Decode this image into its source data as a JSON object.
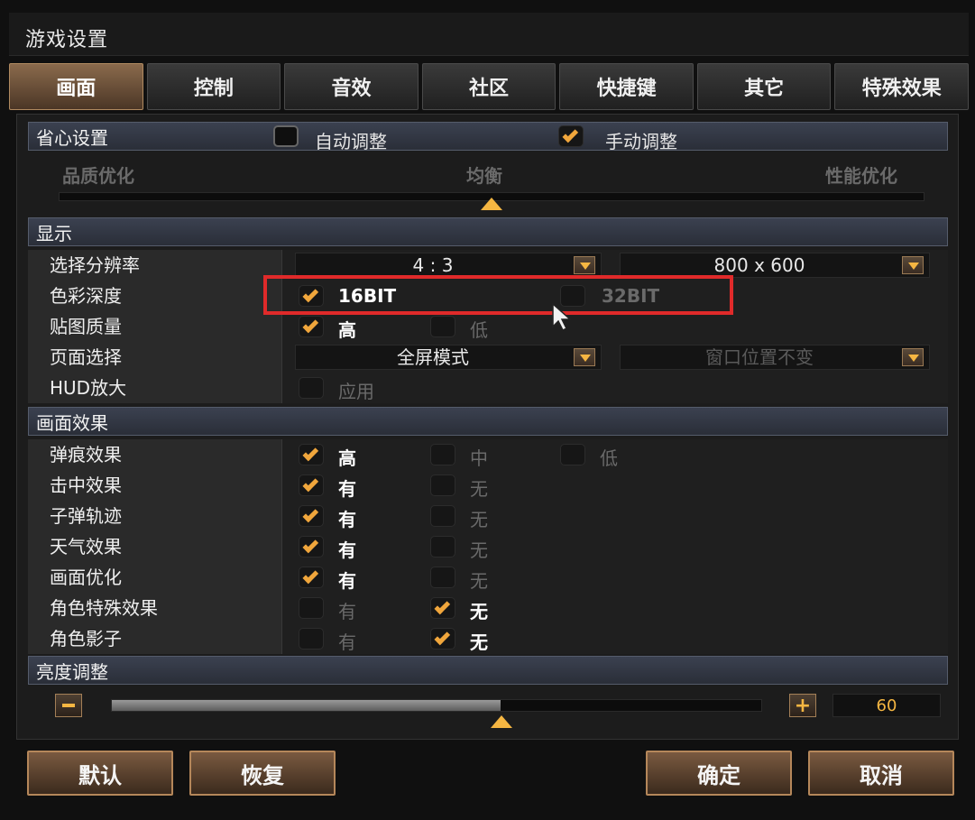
{
  "window": {
    "title": "游戏设置"
  },
  "tabs": [
    {
      "label": "画面",
      "active": true
    },
    {
      "label": "控制",
      "active": false
    },
    {
      "label": "音效",
      "active": false
    },
    {
      "label": "社区",
      "active": false
    },
    {
      "label": "快捷键",
      "active": false
    },
    {
      "label": "其它",
      "active": false
    },
    {
      "label": "特殊效果",
      "active": false
    }
  ],
  "easy": {
    "title": "省心设置",
    "auto_label": "自动调整",
    "auto_checked": false,
    "manual_label": "手动调整",
    "manual_checked": true,
    "quality_label": "品质优化",
    "balanced_label": "均衡",
    "performance_label": "性能优化",
    "slider_position": 0.5
  },
  "display": {
    "title": "显示",
    "resolution_label": "选择分辨率",
    "aspect_value": "4 : 3",
    "resolution_value": "800 x 600",
    "color_label": "色彩深度",
    "color_16": "16BIT",
    "color_16_checked": true,
    "color_32": "32BIT",
    "color_32_checked": false,
    "texture_label": "贴图质量",
    "texture_high": "高",
    "texture_high_checked": true,
    "texture_low": "低",
    "texture_low_checked": false,
    "page_label": "页面选择",
    "page_mode": "全屏模式",
    "window_position": "窗口位置不变",
    "hud_label": "HUD放大",
    "hud_apply": "应用",
    "hud_checked": false
  },
  "effects": {
    "title": "画面效果",
    "rows": [
      {
        "label": "弹痕效果",
        "options": [
          {
            "text": "高",
            "checked": true
          },
          {
            "text": "中",
            "checked": false
          },
          {
            "text": "低",
            "checked": false
          }
        ]
      },
      {
        "label": "击中效果",
        "options": [
          {
            "text": "有",
            "checked": true
          },
          {
            "text": "无",
            "checked": false
          }
        ]
      },
      {
        "label": "子弹轨迹",
        "options": [
          {
            "text": "有",
            "checked": true
          },
          {
            "text": "无",
            "checked": false
          }
        ]
      },
      {
        "label": "天气效果",
        "options": [
          {
            "text": "有",
            "checked": true
          },
          {
            "text": "无",
            "checked": false
          }
        ]
      },
      {
        "label": "画面优化",
        "options": [
          {
            "text": "有",
            "checked": true
          },
          {
            "text": "无",
            "checked": false
          }
        ]
      },
      {
        "label": "角色特殊效果",
        "options": [
          {
            "text": "有",
            "checked": false
          },
          {
            "text": "无",
            "checked": true
          }
        ]
      },
      {
        "label": "角色影子",
        "options": [
          {
            "text": "有",
            "checked": false
          },
          {
            "text": "无",
            "checked": true
          }
        ]
      }
    ]
  },
  "brightness": {
    "title": "亮度调整",
    "value": "60",
    "fill_fraction": 0.6
  },
  "buttons": {
    "default": "默认",
    "restore": "恢复",
    "confirm": "确定",
    "cancel": "取消"
  },
  "colors": {
    "accent": "#f5b642",
    "highlight_box": "#e02a2a"
  }
}
